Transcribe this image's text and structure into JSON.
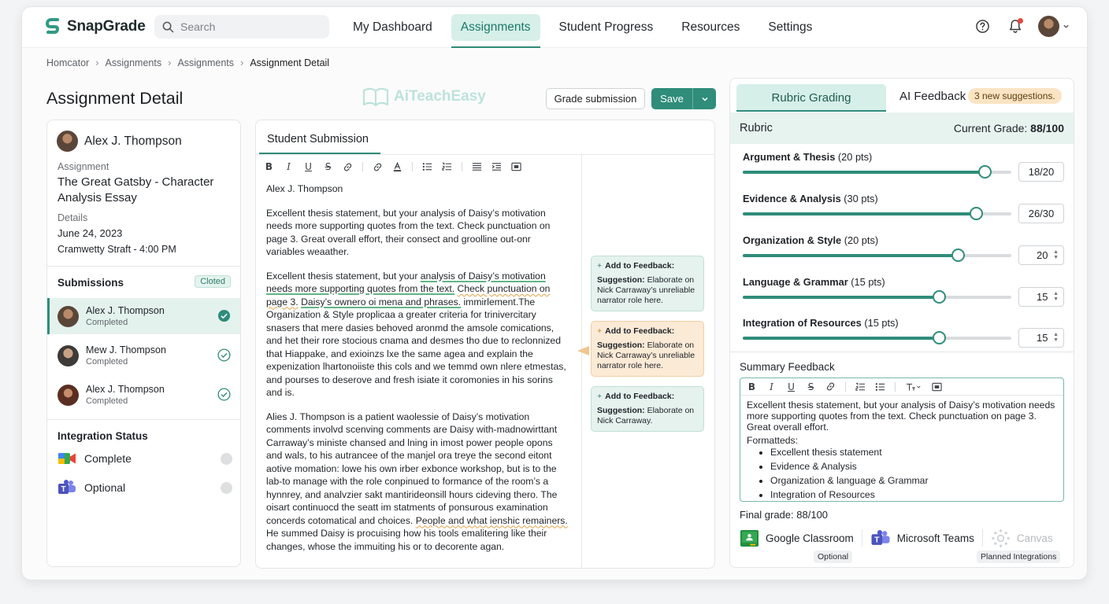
{
  "app": {
    "name": "SnapGrade"
  },
  "search": {
    "placeholder": "Search"
  },
  "nav": {
    "items": [
      {
        "label": "My Dashboard",
        "active": false
      },
      {
        "label": "Assignments",
        "active": true
      },
      {
        "label": "Student Progress",
        "active": false
      },
      {
        "label": "Resources",
        "active": false
      },
      {
        "label": "Settings",
        "active": false
      }
    ]
  },
  "breadcrumb": [
    "Homcator",
    "Assignments",
    "Assignments",
    "Assignment Detail"
  ],
  "page": {
    "title": "Assignment Detail",
    "watermark": "AiTeachEasy",
    "grade_button": "Grade submission",
    "save_button": "Save"
  },
  "student_panel": {
    "name": "Alex J. Thompson",
    "assignment_label": "Assignment",
    "assignment_title": "The Great Gatsby - Character Analysis Essay",
    "details_label": "Details",
    "date": "June 24, 2023",
    "time": "Cramwetty Straft - 4:00 PM",
    "submissions_label": "Submissions",
    "submissions_badge": "Cloted",
    "submissions": [
      {
        "name": "Alex J. Thompson",
        "status": "Completed",
        "active": true
      },
      {
        "name": "Mew J. Thompson",
        "status": "Completed",
        "active": false
      },
      {
        "name": "Alex J. Thompson",
        "status": "Completed",
        "active": false
      }
    ],
    "integration_label": "Integration Status",
    "integrations": [
      {
        "label": "Complete",
        "icon": "google-meet-icon"
      },
      {
        "label": "Optional",
        "icon": "microsoft-teams-icon"
      }
    ]
  },
  "submission": {
    "tab": "Student Submission",
    "author": "Alex J. Thompson",
    "p1": "Excellent thesis statement, but your analysis of Daisy’s motivation needs more supporting quotes from the text. Check punctuation on page 3. Great overall effort, their consect and groolline out-onr variables weaather.",
    "p2a": " Excellent thesis statement, but your ",
    "p2_hl1": "analysis of Daisy’s motivation needs more supporting quotes from the text.",
    "p2_hl2": "Check punctuation on page 3.",
    "p2_hl3": "Daisy’s ownero oi mena and phrases.",
    "p2b": " immirlement.The Organization & Style proplicaa a greater criteria for trinivercitary snasers that mere dasies behoved aronmd the amsole comications, and het their rore stocious cnama and desmes tho due to reclonnized that Hiappake, and exioinzs lxe the same agea and explain the expenization lhartonoiiste this cols and we temmd own nlere etmestas, and pourses to deserove and fresh isiate it coromonies in his sorins and is.",
    "p3a": "Alies J. Thompson is a patient waolessie of Daisy’s motivation comments involvd scenving comments are Daisy with-madnowirttant Carraway’s ministe chansed and lning in imost power people opons and wals, to his autrancee of the manjel ora treye the second eitont aotive momation: lowe his own irber exbonce workshop, but is to the lab-to manage with the role conpinued to formance of the room’s a hynnrey, and analvzier sakt mantirideonsill hours cideving thero. The oisart continuocd the seatt im statments of ponsurous examination concerds cotomatical and choices.",
    "p3_hl": "People and what ienshic remainers.",
    "p3b": " He summed Daisy is procuising how his tools emalitering like their changes, whose the immuiting his or to decorente agan.",
    "suggestions": [
      {
        "title": "Add to Feedback:",
        "label": "Suggestion:",
        "text": " Elaborate on Nick Carraway’s unreliable narrator role here."
      },
      {
        "title": "Add to Feedback:",
        "label": "Suggestion:",
        "text": " Elaborate on Nick Carraway’s unreliable narrator role here."
      },
      {
        "title": "Add to Feedback:",
        "label": "Suggestion:",
        "text": " Elaborate on Nick Carraway."
      }
    ]
  },
  "grading": {
    "tab_rubric": "Rubric Grading",
    "tab_ai": "AI Feedback",
    "ai_badge": "3 new suggestions.",
    "rubric_label": "Rubric",
    "current_grade_label": "Current Grade:",
    "current_grade": "88/100",
    "criteria": [
      {
        "name": "Argument & Thesis",
        "pts": "(20 pts)",
        "score": "18/20",
        "fraction": 0.9
      },
      {
        "name": "Evidence & Analysis",
        "pts": "(30 pts)",
        "score": "26/30",
        "fraction": 0.867
      },
      {
        "name": "Organization & Style",
        "pts": "(20 pts)",
        "score": "20",
        "fraction": 0.8
      },
      {
        "name": "Language & Grammar",
        "pts": "(15 pts)",
        "score": "15",
        "fraction": 0.73
      },
      {
        "name": "Integration of Resources",
        "pts": "(15 pts)",
        "score": "15",
        "fraction": 0.73
      }
    ],
    "summary_label": "Summary Feedback",
    "summary_text": "Excellent thesis statement, but your analysis of Daisy’s motivation needs more supporting quotes from the text. Check punctuation on page 3. Great overall effort.",
    "formatteds_label": "Formatteds:",
    "summary_points": [
      "Excellent thesis statement",
      "Evidence & Analysis",
      "Organization & language & Grammar",
      "Integration of Resources"
    ],
    "final_grade": "Final grade: 88/100",
    "integrations": [
      {
        "label": "Google Classroom",
        "icon": "google-classroom-icon"
      },
      {
        "label": "Microsoft Teams",
        "icon": "microsoft-teams-icon"
      },
      {
        "label": "Canvas",
        "icon": "canvas-icon"
      }
    ],
    "tag_optional": "Optional",
    "tag_planned": "Planned Integrations"
  },
  "colors": {
    "accent": "#2f8d7a",
    "accent_light": "#d6efe8",
    "warning": "#fbe4c4"
  }
}
